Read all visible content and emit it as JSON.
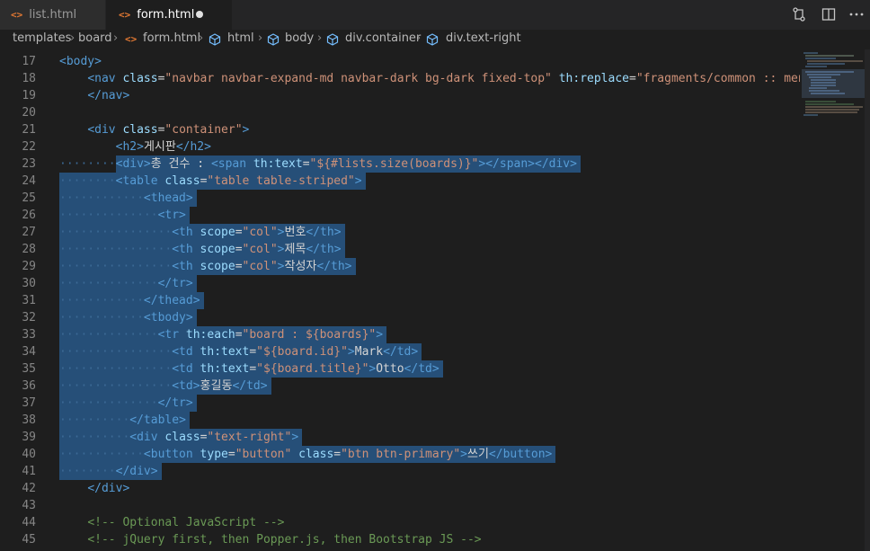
{
  "tabs": [
    {
      "label": "list.html",
      "icon": "html-file-icon",
      "active": false
    },
    {
      "label": "form.html",
      "icon": "html-file-icon",
      "active": true,
      "modified": true
    }
  ],
  "breadcrumb": [
    "templates",
    "board",
    "form.html",
    "html",
    "body",
    "div.container",
    "div.text-right"
  ],
  "title_actions": [
    "source-control-icon",
    "split-editor-icon",
    "more-icon"
  ],
  "colors": {
    "background": "#1e1e1e",
    "selection": "#264f78",
    "tag": "#569cd6",
    "attr": "#9cdcfe",
    "string": "#ce9178",
    "comment": "#6a9955",
    "text": "#d4d4d4"
  },
  "lines": [
    {
      "n": "17",
      "indent": 0,
      "sel": false,
      "tokens": [
        {
          "t": "t",
          "v": "<body>"
        }
      ]
    },
    {
      "n": "18",
      "indent": 4,
      "sel": false,
      "tokens": [
        {
          "t": "t",
          "v": "<nav"
        },
        {
          "t": "x",
          "v": " "
        },
        {
          "t": "a",
          "v": "class"
        },
        {
          "t": "x",
          "v": "="
        },
        {
          "t": "s",
          "v": "\"navbar navbar-expand-md navbar-dark bg-dark fixed-top\""
        },
        {
          "t": "x",
          "v": " "
        },
        {
          "t": "a",
          "v": "th:replace"
        },
        {
          "t": "x",
          "v": "="
        },
        {
          "t": "s",
          "v": "\"fragments/common :: menu"
        }
      ]
    },
    {
      "n": "19",
      "indent": 4,
      "sel": false,
      "tokens": [
        {
          "t": "t",
          "v": "</nav>"
        }
      ]
    },
    {
      "n": "20",
      "indent": 0,
      "sel": false,
      "tokens": []
    },
    {
      "n": "21",
      "indent": 4,
      "sel": false,
      "tokens": [
        {
          "t": "t",
          "v": "<div"
        },
        {
          "t": "x",
          "v": " "
        },
        {
          "t": "a",
          "v": "class"
        },
        {
          "t": "x",
          "v": "="
        },
        {
          "t": "s",
          "v": "\"container\""
        },
        {
          "t": "t",
          "v": ">"
        }
      ]
    },
    {
      "n": "22",
      "indent": 8,
      "sel": false,
      "tokens": [
        {
          "t": "t",
          "v": "<h2>"
        },
        {
          "t": "x",
          "v": "게시판"
        },
        {
          "t": "t",
          "v": "</h2>"
        }
      ]
    },
    {
      "n": "23",
      "indent": 8,
      "sel": true,
      "tokens": [
        {
          "t": "t",
          "v": "<div>"
        },
        {
          "t": "x",
          "v": "총 건수 : "
        },
        {
          "t": "t",
          "v": "<span"
        },
        {
          "t": "x",
          "v": " "
        },
        {
          "t": "a",
          "v": "th:text"
        },
        {
          "t": "x",
          "v": "="
        },
        {
          "t": "s",
          "v": "\"${#lists.size(boards)}\""
        },
        {
          "t": "t",
          "v": "></span></div>"
        }
      ]
    },
    {
      "n": "24",
      "indent": 8,
      "sel": true,
      "tokens": [
        {
          "t": "t",
          "v": "<table"
        },
        {
          "t": "x",
          "v": " "
        },
        {
          "t": "a",
          "v": "class"
        },
        {
          "t": "x",
          "v": "="
        },
        {
          "t": "s",
          "v": "\"table table-striped\""
        },
        {
          "t": "t",
          "v": ">"
        }
      ]
    },
    {
      "n": "25",
      "indent": 12,
      "sel": true,
      "tokens": [
        {
          "t": "t",
          "v": "<thead>"
        }
      ]
    },
    {
      "n": "26",
      "indent": 14,
      "sel": true,
      "tokens": [
        {
          "t": "t",
          "v": "<tr>"
        }
      ]
    },
    {
      "n": "27",
      "indent": 16,
      "sel": true,
      "tokens": [
        {
          "t": "t",
          "v": "<th"
        },
        {
          "t": "x",
          "v": " "
        },
        {
          "t": "a",
          "v": "scope"
        },
        {
          "t": "x",
          "v": "="
        },
        {
          "t": "s",
          "v": "\"col\""
        },
        {
          "t": "t",
          "v": ">"
        },
        {
          "t": "x",
          "v": "번호"
        },
        {
          "t": "t",
          "v": "</th>"
        }
      ]
    },
    {
      "n": "28",
      "indent": 16,
      "sel": true,
      "tokens": [
        {
          "t": "t",
          "v": "<th"
        },
        {
          "t": "x",
          "v": " "
        },
        {
          "t": "a",
          "v": "scope"
        },
        {
          "t": "x",
          "v": "="
        },
        {
          "t": "s",
          "v": "\"col\""
        },
        {
          "t": "t",
          "v": ">"
        },
        {
          "t": "x",
          "v": "제목"
        },
        {
          "t": "t",
          "v": "</th>"
        }
      ]
    },
    {
      "n": "29",
      "indent": 16,
      "sel": true,
      "tokens": [
        {
          "t": "t",
          "v": "<th"
        },
        {
          "t": "x",
          "v": " "
        },
        {
          "t": "a",
          "v": "scope"
        },
        {
          "t": "x",
          "v": "="
        },
        {
          "t": "s",
          "v": "\"col\""
        },
        {
          "t": "t",
          "v": ">"
        },
        {
          "t": "x",
          "v": "작성자"
        },
        {
          "t": "t",
          "v": "</th>"
        }
      ]
    },
    {
      "n": "30",
      "indent": 14,
      "sel": true,
      "tokens": [
        {
          "t": "t",
          "v": "</tr>"
        }
      ]
    },
    {
      "n": "31",
      "indent": 12,
      "sel": true,
      "tokens": [
        {
          "t": "t",
          "v": "</thead>"
        }
      ]
    },
    {
      "n": "32",
      "indent": 12,
      "sel": true,
      "tokens": [
        {
          "t": "t",
          "v": "<tbody>"
        }
      ]
    },
    {
      "n": "33",
      "indent": 14,
      "sel": true,
      "tokens": [
        {
          "t": "t",
          "v": "<tr"
        },
        {
          "t": "x",
          "v": " "
        },
        {
          "t": "a",
          "v": "th:each"
        },
        {
          "t": "x",
          "v": "="
        },
        {
          "t": "s",
          "v": "\"board : ${boards}\""
        },
        {
          "t": "t",
          "v": ">"
        }
      ]
    },
    {
      "n": "34",
      "indent": 16,
      "sel": true,
      "tokens": [
        {
          "t": "t",
          "v": "<td"
        },
        {
          "t": "x",
          "v": " "
        },
        {
          "t": "a",
          "v": "th:text"
        },
        {
          "t": "x",
          "v": "="
        },
        {
          "t": "s",
          "v": "\"${board.id}\""
        },
        {
          "t": "t",
          "v": ">"
        },
        {
          "t": "x",
          "v": "Mark"
        },
        {
          "t": "t",
          "v": "</td>"
        }
      ]
    },
    {
      "n": "35",
      "indent": 16,
      "sel": true,
      "tokens": [
        {
          "t": "t",
          "v": "<td"
        },
        {
          "t": "x",
          "v": " "
        },
        {
          "t": "a",
          "v": "th:text"
        },
        {
          "t": "x",
          "v": "="
        },
        {
          "t": "s",
          "v": "\"${board.title}\""
        },
        {
          "t": "t",
          "v": ">"
        },
        {
          "t": "x",
          "v": "Otto"
        },
        {
          "t": "t",
          "v": "</td>"
        }
      ]
    },
    {
      "n": "36",
      "indent": 16,
      "sel": true,
      "tokens": [
        {
          "t": "t",
          "v": "<td>"
        },
        {
          "t": "x",
          "v": "홍길동"
        },
        {
          "t": "t",
          "v": "</td>"
        }
      ]
    },
    {
      "n": "37",
      "indent": 14,
      "sel": true,
      "tokens": [
        {
          "t": "t",
          "v": "</tr>"
        }
      ]
    },
    {
      "n": "38",
      "indent": 10,
      "sel": true,
      "tokens": [
        {
          "t": "t",
          "v": "</table>"
        }
      ]
    },
    {
      "n": "39",
      "indent": 10,
      "sel": true,
      "tokens": [
        {
          "t": "t",
          "v": "<div"
        },
        {
          "t": "x",
          "v": " "
        },
        {
          "t": "a",
          "v": "class"
        },
        {
          "t": "x",
          "v": "="
        },
        {
          "t": "s",
          "v": "\"text-right\""
        },
        {
          "t": "t",
          "v": ">"
        }
      ]
    },
    {
      "n": "40",
      "indent": 12,
      "sel": true,
      "tokens": [
        {
          "t": "t",
          "v": "<button"
        },
        {
          "t": "x",
          "v": " "
        },
        {
          "t": "a",
          "v": "type"
        },
        {
          "t": "x",
          "v": "="
        },
        {
          "t": "s",
          "v": "\"button\""
        },
        {
          "t": "x",
          "v": " "
        },
        {
          "t": "a",
          "v": "class"
        },
        {
          "t": "x",
          "v": "="
        },
        {
          "t": "s",
          "v": "\"btn btn-primary\""
        },
        {
          "t": "t",
          "v": ">"
        },
        {
          "t": "x",
          "v": "쓰기"
        },
        {
          "t": "t",
          "v": "</button>"
        }
      ]
    },
    {
      "n": "41",
      "indent": 8,
      "sel": true,
      "tokens": [
        {
          "t": "t",
          "v": "</div>"
        }
      ]
    },
    {
      "n": "42",
      "indent": 4,
      "sel": false,
      "tokens": [
        {
          "t": "t",
          "v": "</div>"
        }
      ]
    },
    {
      "n": "43",
      "indent": 0,
      "sel": false,
      "tokens": []
    },
    {
      "n": "44",
      "indent": 4,
      "sel": false,
      "tokens": [
        {
          "t": "c",
          "v": "<!-- Optional JavaScript -->"
        }
      ]
    },
    {
      "n": "45",
      "indent": 4,
      "sel": false,
      "tokens": [
        {
          "t": "c",
          "v": "<!-- jQuery first, then Popper.js, then Bootstrap JS -->"
        }
      ]
    }
  ]
}
